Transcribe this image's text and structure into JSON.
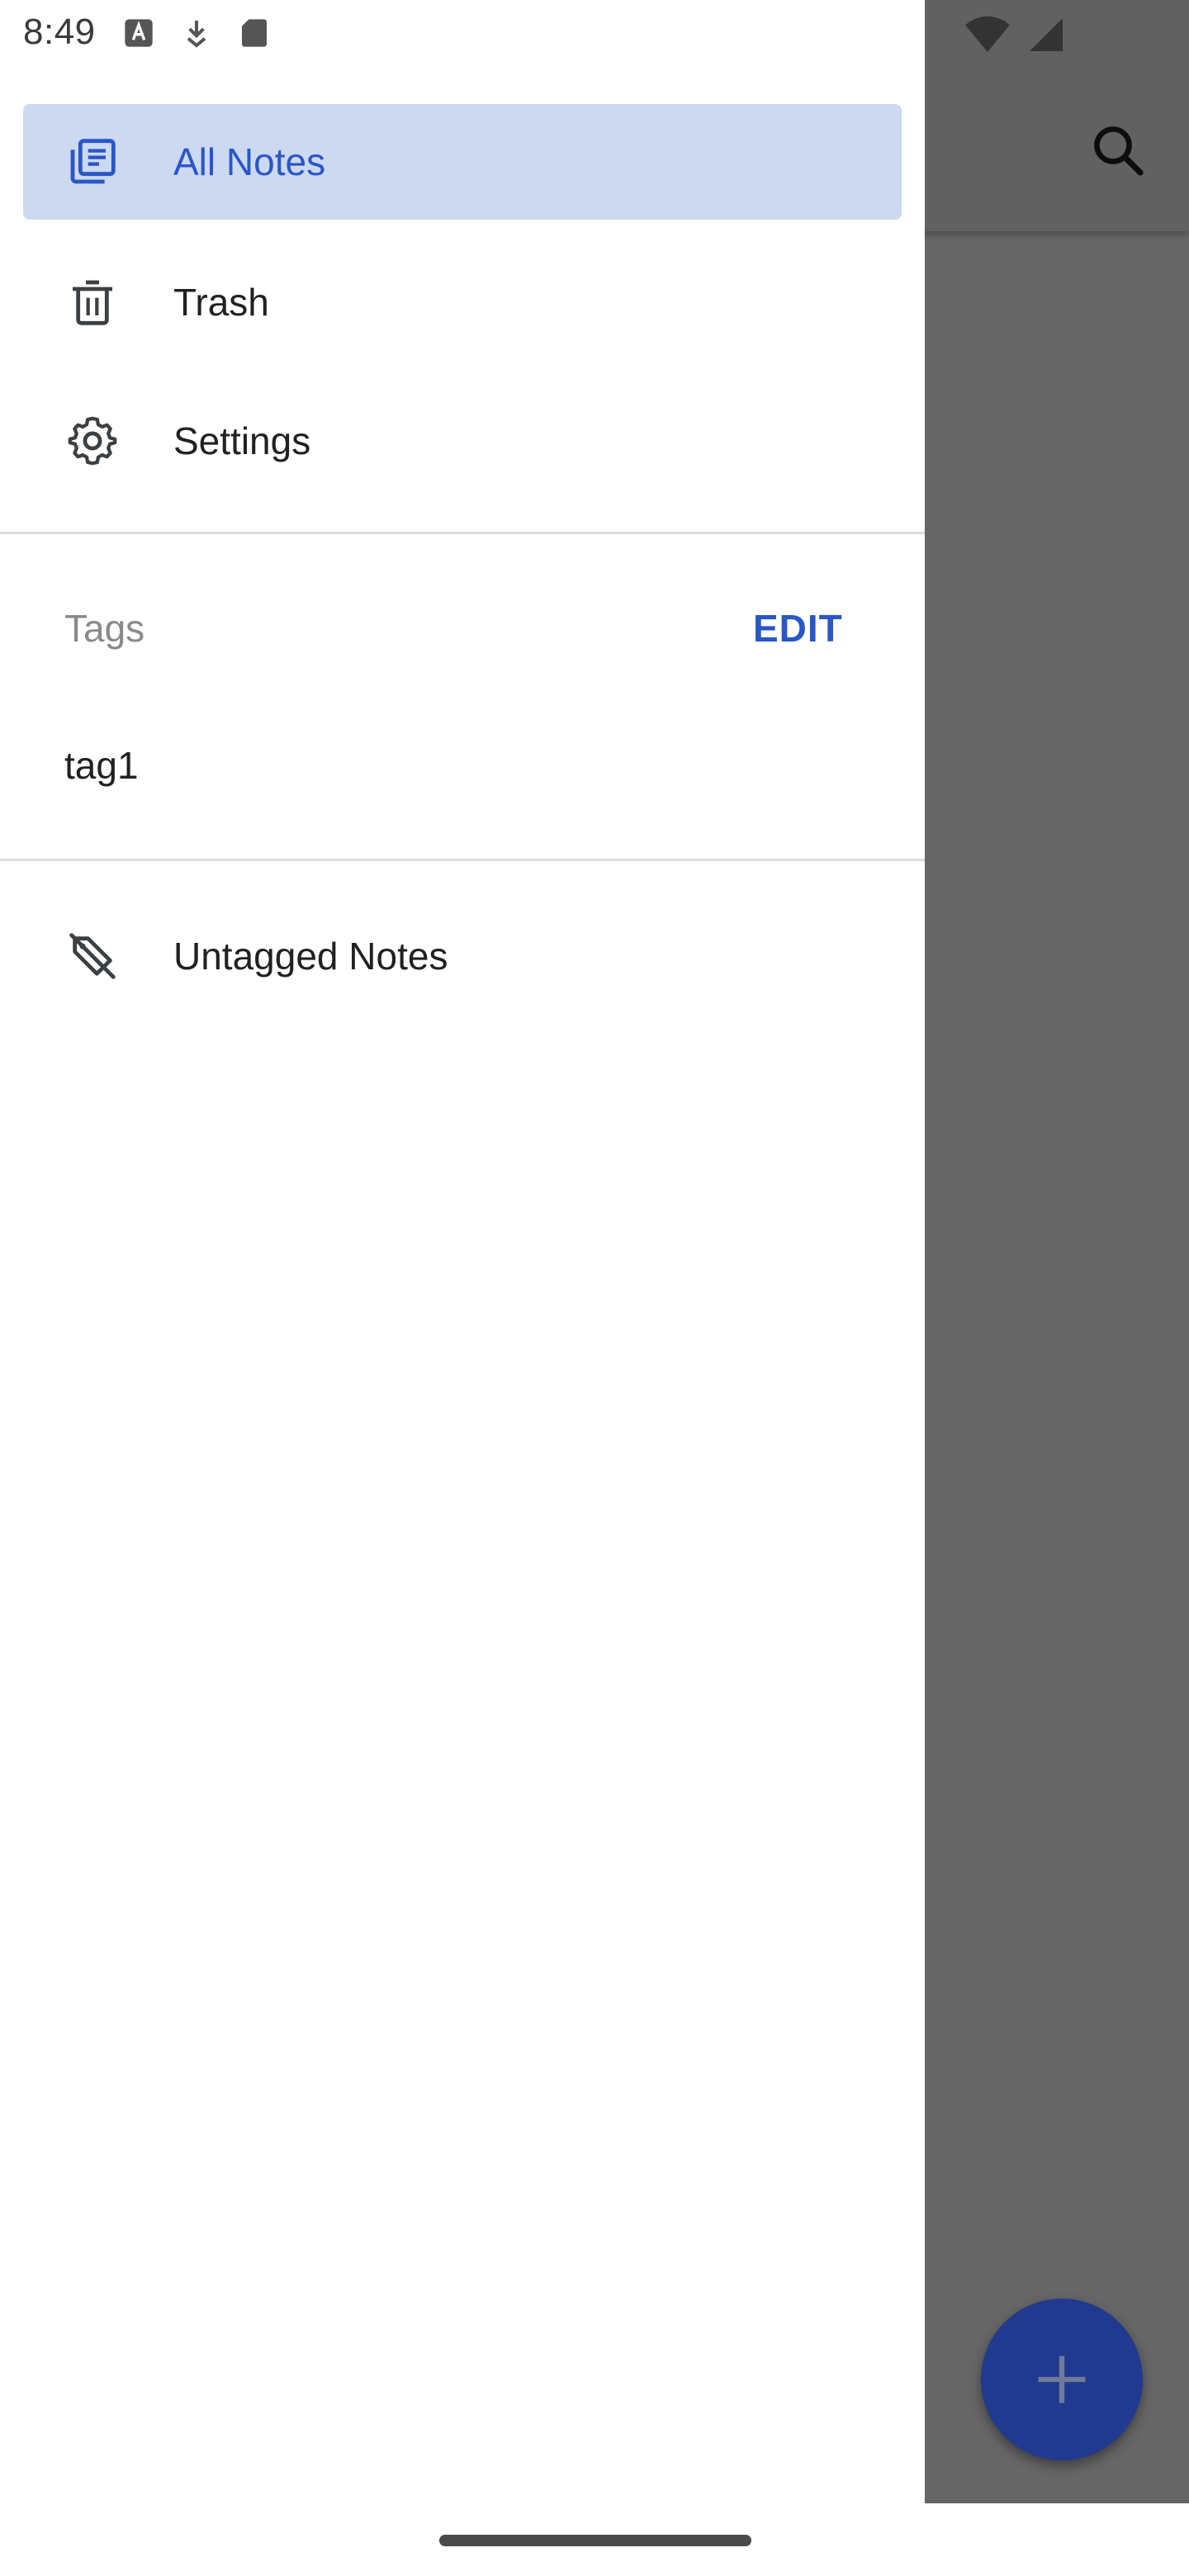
{
  "status_bar": {
    "time": "8:49",
    "left_icons": [
      "text-recognition-icon",
      "download-icon",
      "sd-card-icon"
    ],
    "right_icons": [
      "wifi-icon",
      "signal-icon"
    ]
  },
  "app": {
    "search_icon": "search-icon",
    "fab_icon": "plus-icon",
    "fab_color": "#213a8f"
  },
  "drawer": {
    "nav_items": [
      {
        "label": "All Notes",
        "icon": "notes-stack-icon",
        "active": true
      },
      {
        "label": "Trash",
        "icon": "trash-icon",
        "active": false
      },
      {
        "label": "Settings",
        "icon": "gear-icon",
        "active": false
      }
    ],
    "tags_header": "Tags",
    "tags_edit": "EDIT",
    "tags": [
      {
        "label": "tag1"
      }
    ],
    "untagged": {
      "label": "Untagged Notes",
      "icon": "tag-off-icon"
    }
  },
  "colors": {
    "accent": "#2a56c6",
    "active_bg": "#ccd9f1",
    "text": "#202124",
    "muted": "#8a8a8a"
  }
}
